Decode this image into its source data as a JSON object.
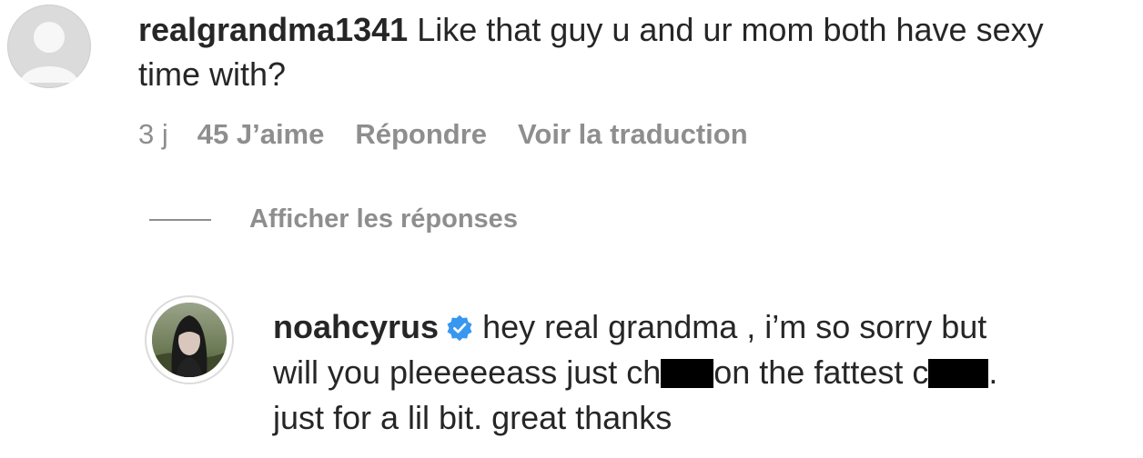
{
  "comment": {
    "username": "realgrandma1341",
    "text": "Like that guy u and ur mom both have sexy time with?",
    "time": "3 j",
    "likes": "45 J’aime",
    "reply_label": "Répondre",
    "translate_label": "Voir la traduction"
  },
  "replies": {
    "show_label": "Afficher les réponses"
  },
  "reply": {
    "username": "noahcyrus",
    "verified": true,
    "text_line1": "hey real grandma , i’m so sorry but",
    "text_part_a": "will you pleeeeeass just ch",
    "text_part_b": "on the fattest c",
    "text_part_c": ".",
    "text_line3": "just for a lil bit. great thanks"
  },
  "colors": {
    "text": "#262626",
    "muted": "#8e8e8e",
    "verified": "#3897f0",
    "avatar_placeholder": "#dbdbdb"
  }
}
